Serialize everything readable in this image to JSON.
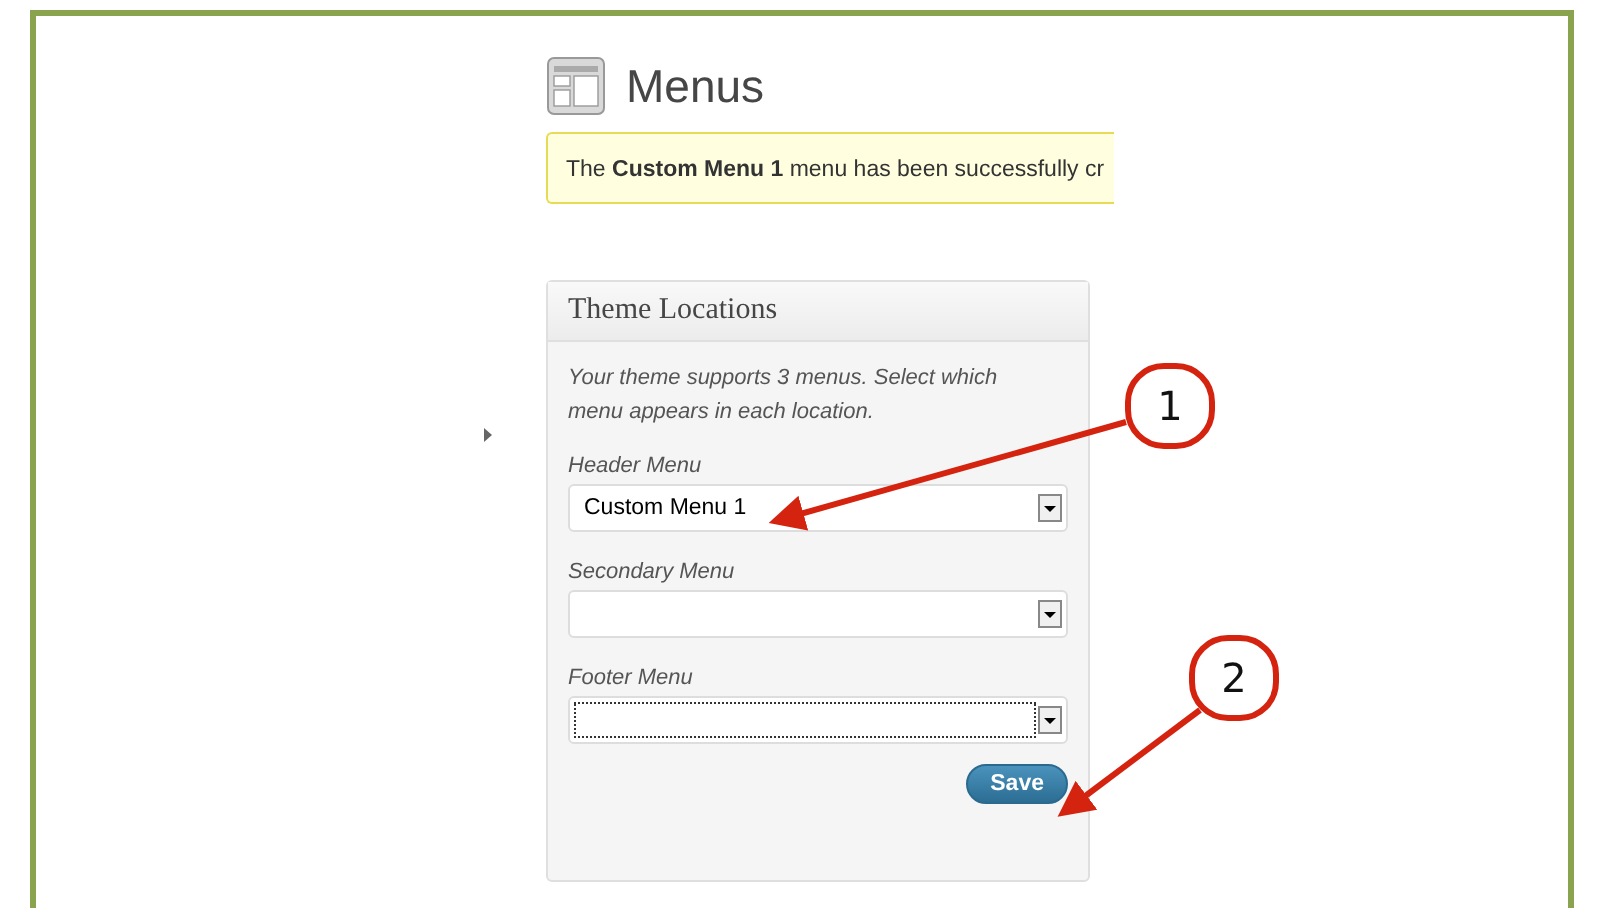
{
  "page": {
    "title": "Menus"
  },
  "notice": {
    "text": "The **Custom Menu 1** menu has been successfully cr"
  },
  "panel": {
    "title": "Theme Locations",
    "description": "Your theme supports 3 menus. Select which menu appears in each location.",
    "locations": [
      {
        "label": "Header Menu",
        "value": "Custom Menu 1",
        "focused": false
      },
      {
        "label": "Secondary Menu",
        "focused": false
      },
      {
        "label": "Footer Menu",
        "focused": true
      }
    ],
    "save_button": "Save"
  },
  "annotations": [
    {
      "number": "1"
    },
    {
      "number": "2"
    }
  ]
}
